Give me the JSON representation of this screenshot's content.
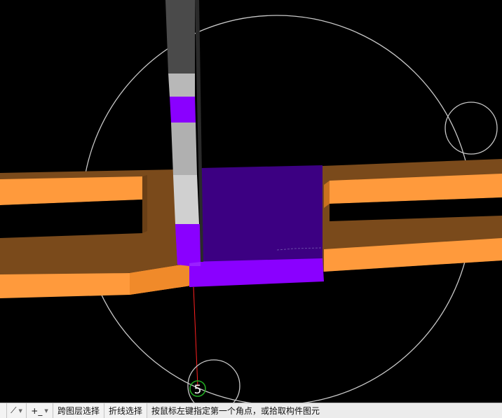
{
  "viewport": {
    "point_label": "5",
    "colors": {
      "background": "#000000",
      "beam_top": "#ff9a3c",
      "beam_side": "#7a4a1b",
      "column_top": "#3c0082",
      "column_face": "#8a00ff",
      "column_right_face": "#5a00a8",
      "slab_dark": "#4a4a4a",
      "slab_light": "#d0d0d0",
      "snap_circle": "#c8c8c8",
      "guide_line": "#ff2020",
      "snap_marker": "#22aa22"
    }
  },
  "statusbar": {
    "buttons": [
      {
        "icon": "snap-icon",
        "glyph": "⌖"
      },
      {
        "icon": "angle-icon",
        "glyph": "⟋"
      },
      {
        "icon": "coordinate-icon",
        "glyph": "+_"
      }
    ],
    "layer_select_label": "跨图层选择",
    "polyline_select_label": "折线选择",
    "prompt_text": "按鼠标左键指定第一个角点，或拾取构件图元"
  }
}
